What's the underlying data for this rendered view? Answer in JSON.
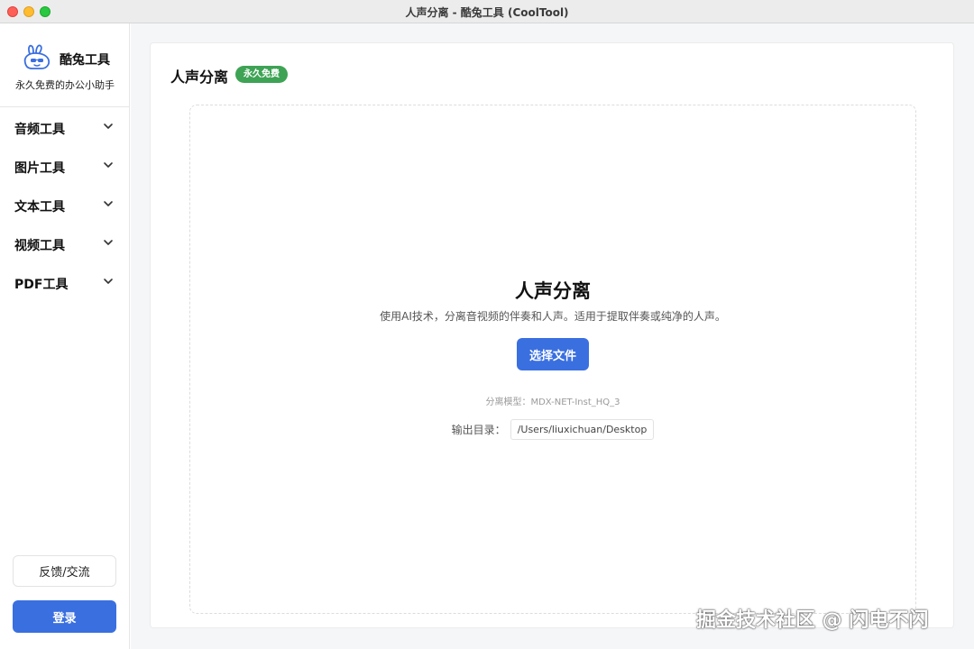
{
  "window": {
    "title": "人声分离 - 酷兔工具 (CoolTool)"
  },
  "brand": {
    "name": "酷兔工具",
    "slogan": "永久免费的办公小助手"
  },
  "sidebar": {
    "items": [
      {
        "label": "音频工具"
      },
      {
        "label": "图片工具"
      },
      {
        "label": "文本工具"
      },
      {
        "label": "视频工具"
      },
      {
        "label": "PDF工具"
      }
    ],
    "feedback_label": "反馈/交流",
    "login_label": "登录"
  },
  "main": {
    "page_title": "人声分离",
    "badge": "永久免费",
    "dropzone": {
      "title": "人声分离",
      "description": "使用AI技术，分离音视频的伴奏和人声。适用于提取伴奏或纯净的人声。",
      "button_label": "选择文件",
      "model_text": "分离模型：MDX-NET-Inst_HQ_3",
      "output_label": "输出目录：",
      "output_path": "/Users/liuxichuan/Desktop"
    }
  },
  "watermark": "掘金技术社区 @ 闪电不闪",
  "colors": {
    "accent": "#3a6fe0",
    "badge": "#3ea355"
  }
}
